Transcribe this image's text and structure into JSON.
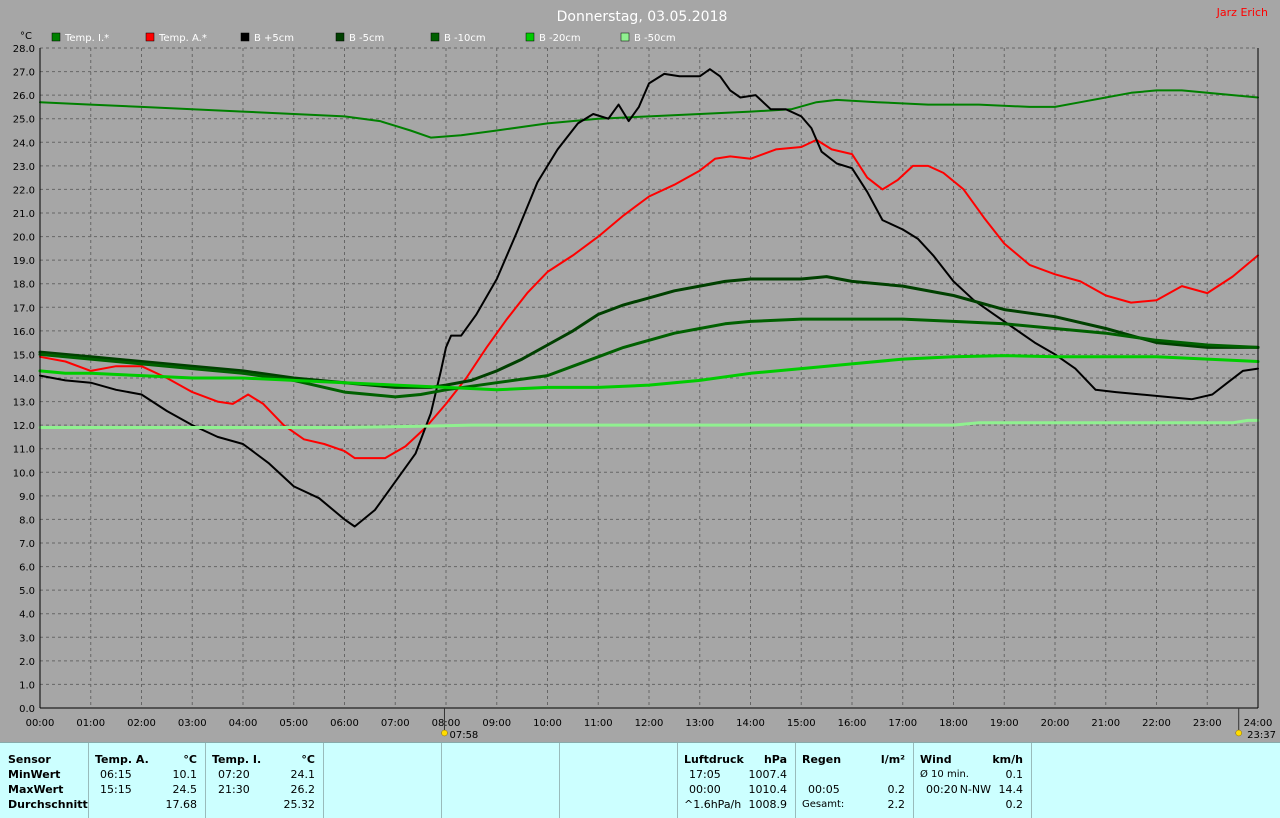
{
  "chart_data": {
    "type": "line",
    "title": "Donnerstag, 03.05.2018",
    "author": "Jarz Erich",
    "ylabel": "°C",
    "ylim": [
      0,
      28
    ],
    "xlim": [
      0,
      24
    ],
    "y_ticks": [
      "0.0",
      "1.0",
      "2.0",
      "3.0",
      "4.0",
      "5.0",
      "6.0",
      "7.0",
      "8.0",
      "9.0",
      "10.0",
      "11.0",
      "12.0",
      "13.0",
      "14.0",
      "15.0",
      "16.0",
      "17.0",
      "18.0",
      "19.0",
      "20.0",
      "21.0",
      "22.0",
      "23.0",
      "24.0",
      "25.0",
      "26.0",
      "27.0",
      "28.0"
    ],
    "x_ticks": [
      "00:00",
      "01:00",
      "02:00",
      "03:00",
      "04:00",
      "05:00",
      "06:00",
      "07:00",
      "08:00",
      "09:00",
      "10:00",
      "11:00",
      "12:00",
      "13:00",
      "14:00",
      "15:00",
      "16:00",
      "17:00",
      "18:00",
      "19:00",
      "20:00",
      "21:00",
      "22:00",
      "23:00",
      "24:00"
    ],
    "grid": true,
    "markers": [
      {
        "label": "07:58",
        "x": 7.97,
        "icon": "sunrise-icon"
      },
      {
        "label": "23:37",
        "x": 23.62,
        "icon": "sunset-icon"
      }
    ],
    "series": [
      {
        "name": "Temp. I.*",
        "color": "#008000",
        "width": 2,
        "points": [
          [
            0,
            25.7
          ],
          [
            1,
            25.6
          ],
          [
            2,
            25.5
          ],
          [
            3,
            25.4
          ],
          [
            4,
            25.3
          ],
          [
            5,
            25.2
          ],
          [
            6,
            25.1
          ],
          [
            6.7,
            24.9
          ],
          [
            7.3,
            24.5
          ],
          [
            7.7,
            24.2
          ],
          [
            8.3,
            24.3
          ],
          [
            9,
            24.5
          ],
          [
            10,
            24.8
          ],
          [
            11,
            25.0
          ],
          [
            12,
            25.1
          ],
          [
            13,
            25.2
          ],
          [
            14,
            25.3
          ],
          [
            14.8,
            25.4
          ],
          [
            15.3,
            25.7
          ],
          [
            15.7,
            25.8
          ],
          [
            16.5,
            25.7
          ],
          [
            17.5,
            25.6
          ],
          [
            18.5,
            25.6
          ],
          [
            19.5,
            25.5
          ],
          [
            20,
            25.5
          ],
          [
            20.5,
            25.7
          ],
          [
            21,
            25.9
          ],
          [
            21.5,
            26.1
          ],
          [
            22,
            26.2
          ],
          [
            22.5,
            26.2
          ],
          [
            23,
            26.1
          ],
          [
            24,
            25.9
          ]
        ]
      },
      {
        "name": "Temp. A.*",
        "color": "#ff0000",
        "width": 2,
        "points": [
          [
            0,
            14.9
          ],
          [
            0.5,
            14.7
          ],
          [
            1,
            14.3
          ],
          [
            1.5,
            14.5
          ],
          [
            2,
            14.5
          ],
          [
            2.5,
            14.0
          ],
          [
            3,
            13.4
          ],
          [
            3.5,
            13.0
          ],
          [
            3.8,
            12.9
          ],
          [
            4.1,
            13.3
          ],
          [
            4.4,
            12.9
          ],
          [
            4.8,
            12.0
          ],
          [
            5.2,
            11.4
          ],
          [
            5.6,
            11.2
          ],
          [
            6,
            10.9
          ],
          [
            6.2,
            10.6
          ],
          [
            6.8,
            10.6
          ],
          [
            7.2,
            11.1
          ],
          [
            7.6,
            11.9
          ],
          [
            8,
            12.9
          ],
          [
            8.4,
            14.0
          ],
          [
            8.8,
            15.3
          ],
          [
            9.2,
            16.5
          ],
          [
            9.6,
            17.6
          ],
          [
            10,
            18.5
          ],
          [
            10.5,
            19.2
          ],
          [
            11,
            20.0
          ],
          [
            11.5,
            20.9
          ],
          [
            12,
            21.7
          ],
          [
            12.5,
            22.2
          ],
          [
            13,
            22.8
          ],
          [
            13.3,
            23.3
          ],
          [
            13.6,
            23.4
          ],
          [
            14,
            23.3
          ],
          [
            14.5,
            23.7
          ],
          [
            15,
            23.8
          ],
          [
            15.3,
            24.1
          ],
          [
            15.6,
            23.7
          ],
          [
            16,
            23.5
          ],
          [
            16.3,
            22.5
          ],
          [
            16.6,
            22.0
          ],
          [
            16.9,
            22.4
          ],
          [
            17.2,
            23.0
          ],
          [
            17.5,
            23.0
          ],
          [
            17.8,
            22.7
          ],
          [
            18.2,
            22.0
          ],
          [
            18.6,
            20.8
          ],
          [
            19,
            19.7
          ],
          [
            19.5,
            18.8
          ],
          [
            20,
            18.4
          ],
          [
            20.5,
            18.1
          ],
          [
            21,
            17.5
          ],
          [
            21.5,
            17.2
          ],
          [
            22,
            17.3
          ],
          [
            22.5,
            17.9
          ],
          [
            23,
            17.6
          ],
          [
            23.5,
            18.3
          ],
          [
            24,
            19.2
          ]
        ]
      },
      {
        "name": "B +5cm",
        "color": "#000000",
        "width": 2,
        "points": [
          [
            0,
            14.1
          ],
          [
            0.5,
            13.9
          ],
          [
            1,
            13.8
          ],
          [
            1.5,
            13.5
          ],
          [
            2,
            13.3
          ],
          [
            2.5,
            12.6
          ],
          [
            3,
            12.0
          ],
          [
            3.5,
            11.5
          ],
          [
            4,
            11.2
          ],
          [
            4.5,
            10.4
          ],
          [
            5,
            9.4
          ],
          [
            5.5,
            8.9
          ],
          [
            6,
            8.0
          ],
          [
            6.2,
            7.7
          ],
          [
            6.6,
            8.4
          ],
          [
            7,
            9.6
          ],
          [
            7.4,
            10.8
          ],
          [
            7.7,
            12.5
          ],
          [
            7.9,
            14.3
          ],
          [
            8.0,
            15.3
          ],
          [
            8.1,
            15.8
          ],
          [
            8.3,
            15.8
          ],
          [
            8.6,
            16.7
          ],
          [
            9,
            18.2
          ],
          [
            9.4,
            20.2
          ],
          [
            9.8,
            22.3
          ],
          [
            10.2,
            23.7
          ],
          [
            10.6,
            24.8
          ],
          [
            10.9,
            25.2
          ],
          [
            11.2,
            25.0
          ],
          [
            11.4,
            25.6
          ],
          [
            11.6,
            24.9
          ],
          [
            11.8,
            25.5
          ],
          [
            12,
            26.5
          ],
          [
            12.3,
            26.9
          ],
          [
            12.6,
            26.8
          ],
          [
            13,
            26.8
          ],
          [
            13.2,
            27.1
          ],
          [
            13.4,
            26.8
          ],
          [
            13.6,
            26.2
          ],
          [
            13.8,
            25.9
          ],
          [
            14.1,
            26.0
          ],
          [
            14.4,
            25.4
          ],
          [
            14.7,
            25.4
          ],
          [
            15,
            25.1
          ],
          [
            15.2,
            24.6
          ],
          [
            15.4,
            23.6
          ],
          [
            15.7,
            23.1
          ],
          [
            16,
            22.9
          ],
          [
            16.3,
            21.9
          ],
          [
            16.6,
            20.7
          ],
          [
            17,
            20.3
          ],
          [
            17.3,
            19.9
          ],
          [
            17.6,
            19.2
          ],
          [
            18,
            18.1
          ],
          [
            18.4,
            17.3
          ],
          [
            18.8,
            16.7
          ],
          [
            19.2,
            16.1
          ],
          [
            19.6,
            15.5
          ],
          [
            20,
            15.0
          ],
          [
            20.4,
            14.4
          ],
          [
            20.8,
            13.5
          ],
          [
            21.2,
            13.4
          ],
          [
            21.7,
            13.3
          ],
          [
            22.2,
            13.2
          ],
          [
            22.7,
            13.1
          ],
          [
            23.1,
            13.3
          ],
          [
            23.4,
            13.8
          ],
          [
            23.7,
            14.3
          ],
          [
            24,
            14.4
          ]
        ]
      },
      {
        "name": "B -5cm",
        "color": "#004000",
        "width": 3,
        "points": [
          [
            0,
            15.1
          ],
          [
            1,
            14.9
          ],
          [
            2,
            14.7
          ],
          [
            3,
            14.5
          ],
          [
            4,
            14.3
          ],
          [
            5,
            14.0
          ],
          [
            6,
            13.8
          ],
          [
            7,
            13.6
          ],
          [
            7.7,
            13.6
          ],
          [
            8,
            13.7
          ],
          [
            8.5,
            13.9
          ],
          [
            9,
            14.3
          ],
          [
            9.5,
            14.8
          ],
          [
            10,
            15.4
          ],
          [
            10.5,
            16.0
          ],
          [
            11,
            16.7
          ],
          [
            11.5,
            17.1
          ],
          [
            12,
            17.4
          ],
          [
            12.5,
            17.7
          ],
          [
            13,
            17.9
          ],
          [
            13.5,
            18.1
          ],
          [
            14,
            18.2
          ],
          [
            15,
            18.2
          ],
          [
            15.5,
            18.3
          ],
          [
            16,
            18.1
          ],
          [
            17,
            17.9
          ],
          [
            18,
            17.5
          ],
          [
            19,
            16.9
          ],
          [
            20,
            16.6
          ],
          [
            21,
            16.1
          ],
          [
            22,
            15.5
          ],
          [
            23,
            15.3
          ],
          [
            24,
            15.3
          ]
        ]
      },
      {
        "name": "B -10cm",
        "color": "#006000",
        "width": 3,
        "points": [
          [
            0,
            15.0
          ],
          [
            1,
            14.8
          ],
          [
            2,
            14.6
          ],
          [
            3,
            14.4
          ],
          [
            4,
            14.2
          ],
          [
            5,
            13.9
          ],
          [
            6,
            13.4
          ],
          [
            7,
            13.2
          ],
          [
            7.5,
            13.3
          ],
          [
            8,
            13.5
          ],
          [
            9,
            13.8
          ],
          [
            10,
            14.1
          ],
          [
            10.5,
            14.5
          ],
          [
            11,
            14.9
          ],
          [
            11.5,
            15.3
          ],
          [
            12,
            15.6
          ],
          [
            12.5,
            15.9
          ],
          [
            13,
            16.1
          ],
          [
            13.5,
            16.3
          ],
          [
            14,
            16.4
          ],
          [
            15,
            16.5
          ],
          [
            16,
            16.5
          ],
          [
            17,
            16.5
          ],
          [
            18,
            16.4
          ],
          [
            19,
            16.3
          ],
          [
            20,
            16.1
          ],
          [
            21,
            15.9
          ],
          [
            22,
            15.6
          ],
          [
            23,
            15.4
          ],
          [
            24,
            15.3
          ]
        ]
      },
      {
        "name": "B -20cm",
        "color": "#00cc00",
        "width": 3,
        "points": [
          [
            0,
            14.3
          ],
          [
            0.5,
            14.2
          ],
          [
            1,
            14.2
          ],
          [
            2,
            14.1
          ],
          [
            3,
            14.0
          ],
          [
            4,
            14.0
          ],
          [
            5,
            13.9
          ],
          [
            6,
            13.8
          ],
          [
            7,
            13.7
          ],
          [
            8,
            13.6
          ],
          [
            9,
            13.5
          ],
          [
            10,
            13.6
          ],
          [
            11,
            13.6
          ],
          [
            12,
            13.7
          ],
          [
            13,
            13.9
          ],
          [
            14,
            14.2
          ],
          [
            15,
            14.4
          ],
          [
            16,
            14.6
          ],
          [
            17,
            14.8
          ],
          [
            18,
            14.9
          ],
          [
            19,
            14.95
          ],
          [
            20,
            14.9
          ],
          [
            21,
            14.9
          ],
          [
            22,
            14.9
          ],
          [
            23,
            14.8
          ],
          [
            24,
            14.7
          ]
        ]
      },
      {
        "name": "B -50cm",
        "color": "#90f090",
        "width": 3,
        "points": [
          [
            0,
            11.9
          ],
          [
            2,
            11.9
          ],
          [
            4,
            11.9
          ],
          [
            6,
            11.9
          ],
          [
            7.5,
            11.95
          ],
          [
            8.5,
            12.0
          ],
          [
            10,
            12.0
          ],
          [
            12,
            12.0
          ],
          [
            14,
            12.0
          ],
          [
            16,
            12.0
          ],
          [
            18,
            12.0
          ],
          [
            18.5,
            12.1
          ],
          [
            20,
            12.1
          ],
          [
            22,
            12.1
          ],
          [
            23.5,
            12.1
          ],
          [
            23.8,
            12.2
          ],
          [
            24,
            12.2
          ]
        ]
      }
    ]
  },
  "stats": {
    "sensor": {
      "header": "Sensor",
      "rows": [
        "MinWert",
        "MaxWert",
        "Durchschnitt"
      ]
    },
    "temp_a": {
      "header": "Temp. A.",
      "unit": "°C",
      "rows": [
        {
          "time": "06:15",
          "value": "10.1"
        },
        {
          "time": "15:15",
          "value": "24.5"
        },
        {
          "time": "",
          "value": "17.68"
        }
      ]
    },
    "temp_i": {
      "header": "Temp. I.",
      "unit": "°C",
      "rows": [
        {
          "time": "07:20",
          "value": "24.1"
        },
        {
          "time": "21:30",
          "value": "26.2"
        },
        {
          "time": "",
          "value": "25.32"
        }
      ]
    },
    "pressure": {
      "header": "Luftdruck",
      "unit": "hPa",
      "rows": [
        {
          "time": "17:05",
          "value": "1007.4"
        },
        {
          "time": "00:00",
          "value": "1010.4"
        },
        {
          "time": "^1.6hPa/h",
          "value": "1008.9"
        }
      ]
    },
    "rain": {
      "header": "Regen",
      "unit": "l/m²",
      "rows": [
        {
          "time": "",
          "value": ""
        },
        {
          "time": "00:05",
          "value": "0.2"
        },
        {
          "time": "Gesamt:",
          "value": "2.2"
        }
      ]
    },
    "wind": {
      "header": "Wind",
      "unit": "km/h",
      "rows": [
        {
          "time": "Ø 10 min.",
          "dir": "",
          "value": "0.1"
        },
        {
          "time": "00:20",
          "dir": "N-NW",
          "value": "14.4"
        },
        {
          "time": "",
          "dir": "",
          "value": "0.2"
        }
      ]
    }
  }
}
